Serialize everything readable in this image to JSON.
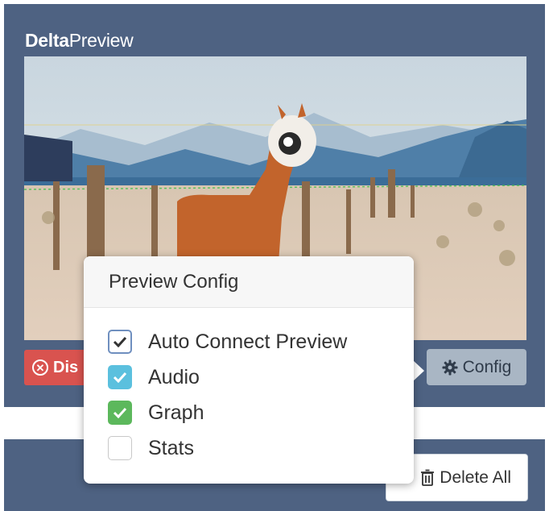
{
  "panel": {
    "title_bold": "Delta",
    "title_regular": "Preview"
  },
  "preview": {
    "image_subject": "llama-in-desert-landscape"
  },
  "buttons": {
    "disconnect_label": "Dis",
    "config_label": "Config",
    "delete_all_label": "Delete All"
  },
  "popover": {
    "title": "Preview Config",
    "options": [
      {
        "label": "Auto Connect Preview",
        "checked": true,
        "style": "outlined"
      },
      {
        "label": "Audio",
        "checked": true,
        "style": "blue"
      },
      {
        "label": "Graph",
        "checked": true,
        "style": "green"
      },
      {
        "label": "Stats",
        "checked": false,
        "style": "empty"
      }
    ]
  },
  "colors": {
    "panel_bg": "#4e6282",
    "danger": "#d9534f",
    "info": "#5bc0de",
    "success": "#5cb85c",
    "config_bg": "#a9b6c4"
  },
  "icons": {
    "disconnect": "times-circle-icon",
    "config": "gear-icon",
    "delete": "trash-icon",
    "check": "check-icon"
  }
}
